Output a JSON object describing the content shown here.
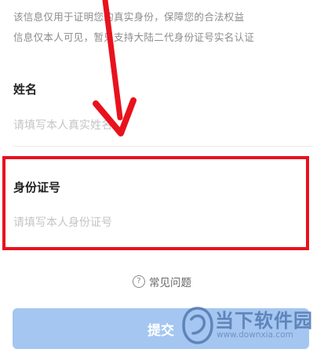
{
  "notice": {
    "line1": "该信息仅用于证明您的真实身份，保障您的合法权益",
    "line2": "信息仅本人可见，暂只支持大陆二代身份证号实名认证"
  },
  "name_field": {
    "label": "姓名",
    "placeholder": "请填写本人真实姓名"
  },
  "id_field": {
    "label": "身份证号",
    "placeholder": "请填写本人身份证号"
  },
  "faq": {
    "icon": "question-circle-icon",
    "label": "常见问题"
  },
  "submit": {
    "label": "提交"
  },
  "watermark": {
    "text": "当下软件园",
    "url": "www.downxia.com"
  },
  "colors": {
    "highlight": "#e8121d",
    "button": "#a4c6f0",
    "watermark": "#5a7fb6"
  }
}
